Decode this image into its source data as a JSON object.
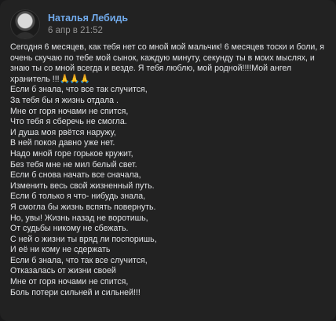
{
  "post": {
    "author": "Наталья Лебидь",
    "date": "6 апр в 21:52",
    "intro": "Сегодня 6 месяцев, как тебя нет со мной мой мальчик! 6 месяцев тоски и боли, я очень скучаю по тебе мой сынок, каждую минуту, секунду ты в моих мыслях, и знаю ты со мной всегда и везде. Я тебя люблю, мой родной!!!!Мой ангел хранитель !!!",
    "intro_emoji": "🙏🙏🙏",
    "poem": [
      "Если б знала, что все так случится,",
      "За тебя бы я жизнь отдала .",
      "Мне от горя ночами не спится,",
      "Что тебя я сберечь не смогла.",
      "И душа моя рвётся наружу,",
      "В ней покоя давно уже нет.",
      "Надо мной горе горькое кружит,",
      "Без тебя мне не мил белый свет.",
      "Если б снова начать все сначала,",
      "Изменить весь свой жизненный путь.",
      "Если б только я что- нибудь знала,",
      "Я смогла бы жизнь вспять повернуть.",
      "Но, увы! Жизнь назад не воротишь,",
      "От судьбы никому не сбежать.",
      "С ней о жизни ты вряд ли поспоришь,",
      "И её ни кому не сдержать",
      "Если б знала, что так все случится,",
      "Отказалась от жизни своей",
      "Мне от горя ночами не спится,",
      "Боль потери сильней и сильней!!!"
    ]
  }
}
